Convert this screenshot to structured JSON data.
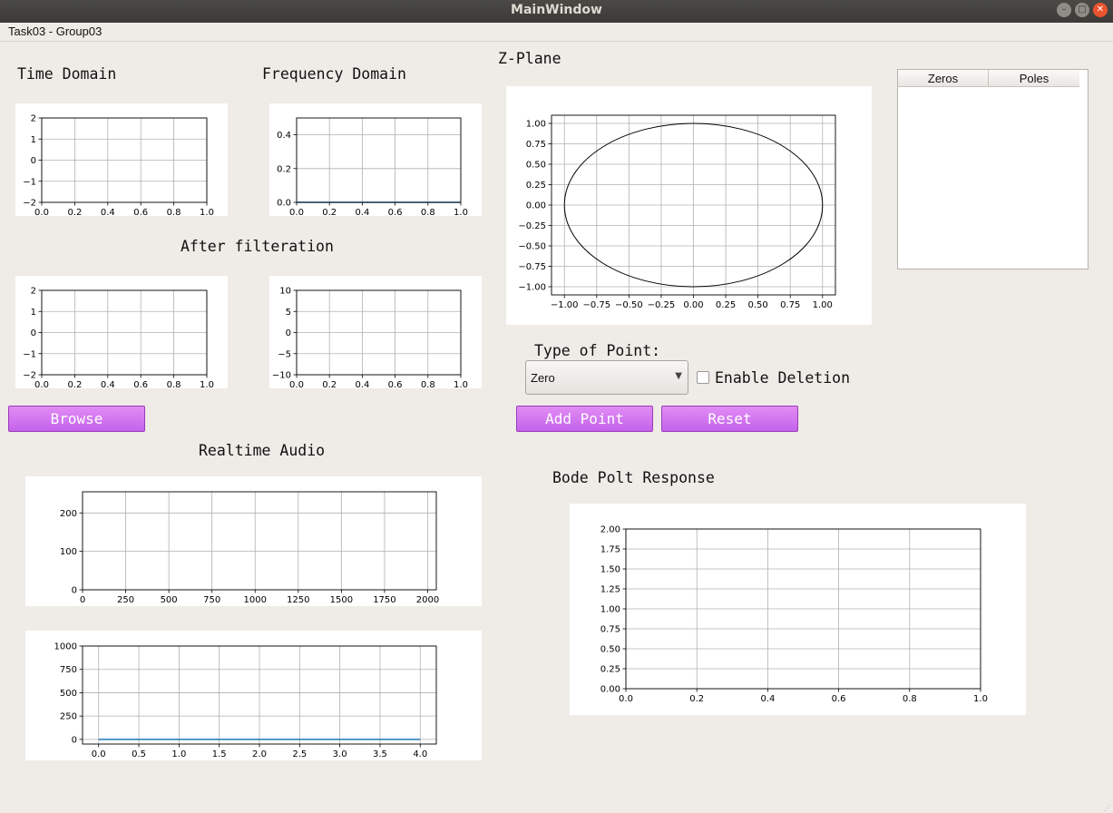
{
  "window": {
    "title": "MainWindow"
  },
  "menu": {
    "items": [
      "Task03 - Group03"
    ]
  },
  "labels": {
    "time_domain": "Time Domain",
    "frequency_domain": "Frequency Domain",
    "after_filteration": "After filteration",
    "z_plane": "Z-Plane",
    "type_of_point": "Type of Point:",
    "realtime_audio": "Realtime Audio",
    "bode": "Bode Polt Response"
  },
  "controls": {
    "browse": "Browse",
    "add_point": "Add Point",
    "reset": "Reset",
    "point_type": {
      "selected": "Zero"
    },
    "enable_deletion": {
      "label": "Enable Deletion",
      "checked": false
    }
  },
  "table": {
    "headers": [
      "Zeros",
      "Poles"
    ],
    "rows": []
  },
  "chart_data": [
    {
      "id": "time_domain",
      "type": "line",
      "xlim": [
        0,
        1
      ],
      "ylim": [
        -2,
        2
      ],
      "xticks": [
        "0.0",
        "0.2",
        "0.4",
        "0.6",
        "0.8",
        "1.0"
      ],
      "yticks": [
        "2",
        "1",
        "0",
        "−1",
        "−2"
      ],
      "grid": true,
      "series": []
    },
    {
      "id": "frequency_domain",
      "type": "line",
      "xlim": [
        0,
        1
      ],
      "ylim": [
        0,
        0.5
      ],
      "xticks": [
        "0.0",
        "0.2",
        "0.4",
        "0.6",
        "0.8",
        "1.0"
      ],
      "yticks": [
        "0.4",
        "0.2",
        "0.0"
      ],
      "grid": true,
      "series": [
        {
          "color": "#1f77b4",
          "x": [
            0,
            1
          ],
          "y": [
            0,
            0
          ]
        }
      ]
    },
    {
      "id": "filtered_time",
      "type": "line",
      "xlim": [
        0,
        1
      ],
      "ylim": [
        -2,
        2
      ],
      "xticks": [
        "0.0",
        "0.2",
        "0.4",
        "0.6",
        "0.8",
        "1.0"
      ],
      "yticks": [
        "2",
        "1",
        "0",
        "−1",
        "−2"
      ],
      "grid": true,
      "series": []
    },
    {
      "id": "filtered_freq",
      "type": "line",
      "xlim": [
        0,
        1
      ],
      "ylim": [
        -10,
        10
      ],
      "xticks": [
        "0.0",
        "0.2",
        "0.4",
        "0.6",
        "0.8",
        "1.0"
      ],
      "yticks": [
        "10",
        "5",
        "0",
        "−5",
        "−10"
      ],
      "grid": true,
      "series": []
    },
    {
      "id": "z_plane",
      "type": "scatter",
      "xlim": [
        -1.1,
        1.1
      ],
      "ylim": [
        -1.1,
        1.1
      ],
      "xticks": [
        "−1.00",
        "−0.75",
        "−0.50",
        "−0.25",
        "0.00",
        "0.25",
        "0.50",
        "0.75",
        "1.00"
      ],
      "yticks": [
        "1.00",
        "0.75",
        "0.50",
        "0.25",
        "0.00",
        "−0.25",
        "−0.50",
        "−0.75",
        "−1.00"
      ],
      "grid": true,
      "unit_circle": true,
      "zeros": [],
      "poles": []
    },
    {
      "id": "realtime_audio",
      "type": "line",
      "xlim": [
        0,
        2050
      ],
      "ylim": [
        0,
        255
      ],
      "xticks": [
        "0",
        "250",
        "500",
        "750",
        "1000",
        "1250",
        "1500",
        "1750",
        "2000"
      ],
      "yticks": [
        "200",
        "100",
        "0"
      ],
      "grid": true,
      "series": []
    },
    {
      "id": "realtime_audio_2",
      "type": "line",
      "xlim": [
        -0.2,
        4.2
      ],
      "ylim": [
        -50,
        1000
      ],
      "xticks": [
        "0.0",
        "0.5",
        "1.0",
        "1.5",
        "2.0",
        "2.5",
        "3.0",
        "3.5",
        "4.0"
      ],
      "yticks": [
        "1000",
        "750",
        "500",
        "250",
        "0"
      ],
      "grid": true,
      "series": [
        {
          "color": "#1f77b4",
          "x": [
            0,
            4
          ],
          "y": [
            0,
            0
          ]
        }
      ]
    },
    {
      "id": "bode",
      "type": "line",
      "xlim": [
        0,
        1
      ],
      "ylim": [
        0,
        2
      ],
      "xticks": [
        "0.0",
        "0.2",
        "0.4",
        "0.6",
        "0.8",
        "1.0"
      ],
      "yticks": [
        "2.00",
        "1.75",
        "1.50",
        "1.25",
        "1.00",
        "0.75",
        "0.50",
        "0.25",
        "0.00"
      ],
      "grid": true,
      "series": []
    }
  ]
}
